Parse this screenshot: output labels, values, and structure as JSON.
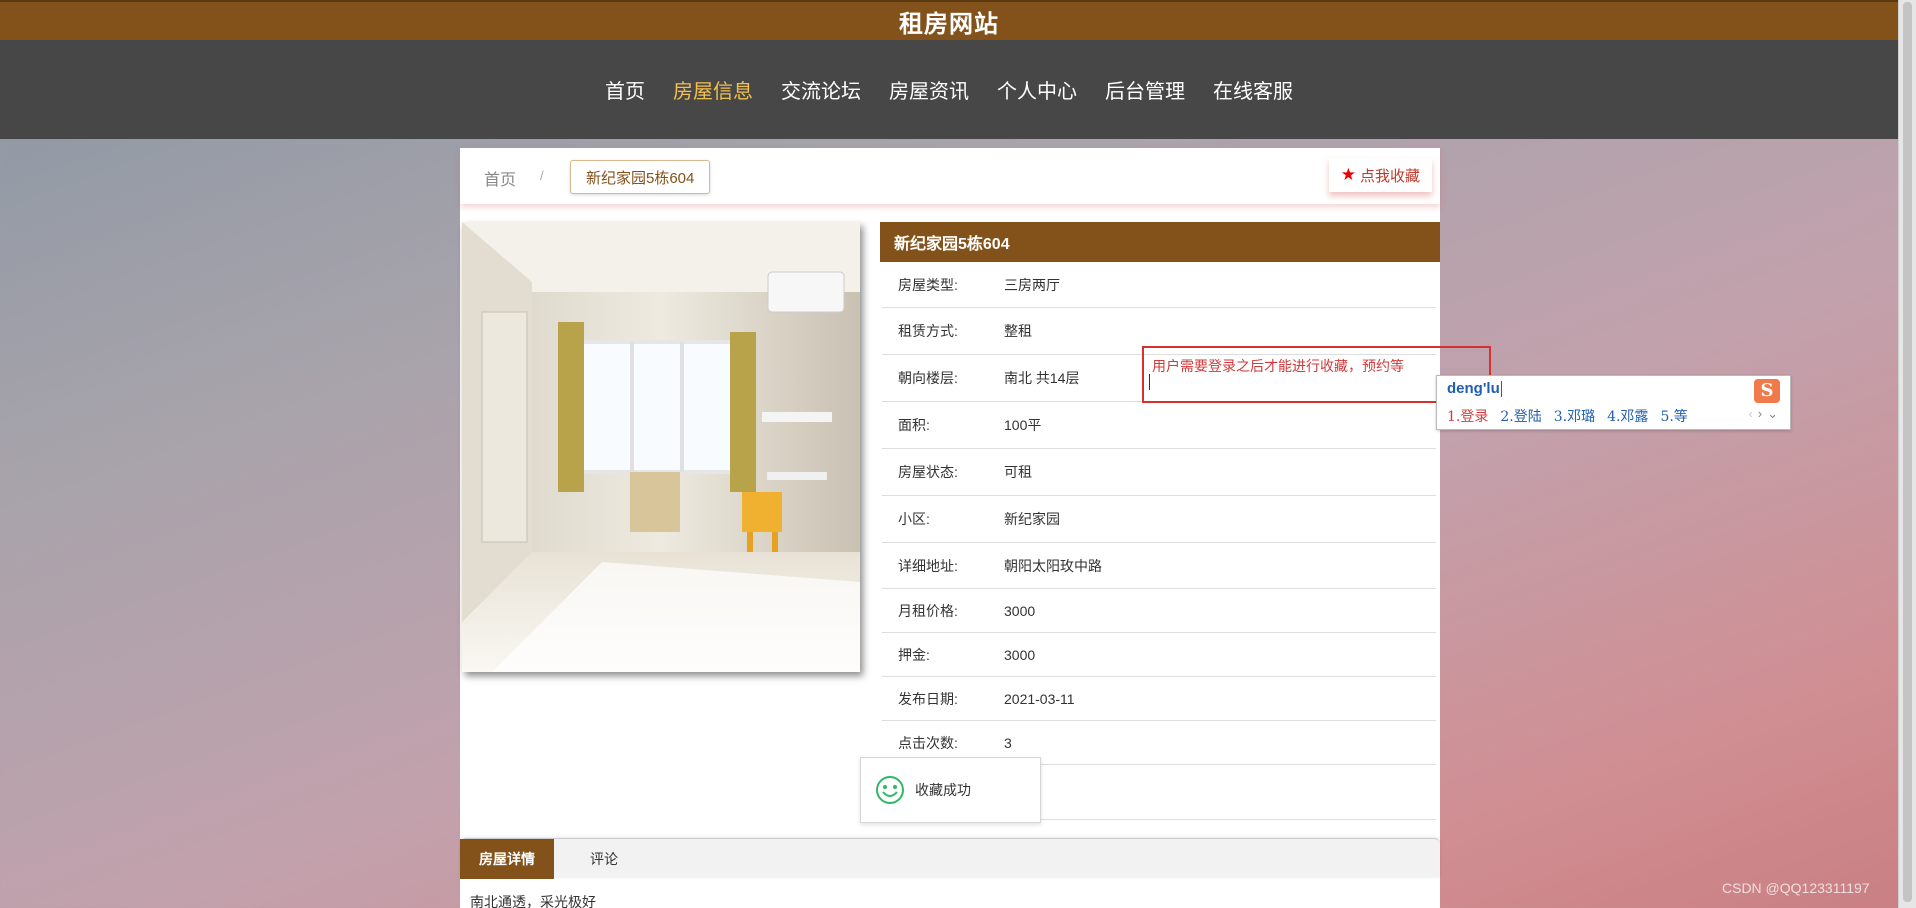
{
  "header": {
    "site_title": "租房网站"
  },
  "nav": {
    "items": [
      "首页",
      "房屋信息",
      "交流论坛",
      "房屋资讯",
      "个人中心",
      "后台管理",
      "在线客服"
    ],
    "active_index": 1
  },
  "breadcrumb": {
    "home": "首页",
    "separator": "/",
    "current": "新纪家园5栋604"
  },
  "favorite_button": {
    "label": "点我收藏"
  },
  "house": {
    "title": "新纪家园5栋604",
    "fields": [
      {
        "label": "房屋类型:",
        "value": "三房两厅"
      },
      {
        "label": "租赁方式:",
        "value": "整租"
      },
      {
        "label": "朝向楼层:",
        "value": "南北 共14层"
      },
      {
        "label": "面积:",
        "value": "100平"
      },
      {
        "label": "房屋状态:",
        "value": "可租"
      },
      {
        "label": "小区:",
        "value": "新纪家园"
      },
      {
        "label": "详细地址:",
        "value": "朝阳太阳玫中路"
      },
      {
        "label": "月租价格:",
        "value": "3000"
      },
      {
        "label": "押金:",
        "value": "3000"
      },
      {
        "label": "发布日期:",
        "value": "2021-03-11"
      },
      {
        "label": "点击次数:",
        "value": "3"
      }
    ]
  },
  "tabs": [
    "房屋详情",
    "评论"
  ],
  "detail_text": "南北通透，采光极好",
  "annotation": {
    "text": "用户需要登录之后才能进行收藏，预约等"
  },
  "ime": {
    "input": "deng'lu",
    "logo": "S",
    "candidates": [
      "1.登录",
      "2.登陆",
      "3.邓璐",
      "4.邓露",
      "5.等"
    ]
  },
  "toast": {
    "text": "收藏成功"
  },
  "watermark": "CSDN @QQ123311197",
  "colors": {
    "brand": "#83521b",
    "nav_bg": "#474747",
    "active_nav": "#f2c14e",
    "favorite": "#c0392b"
  }
}
